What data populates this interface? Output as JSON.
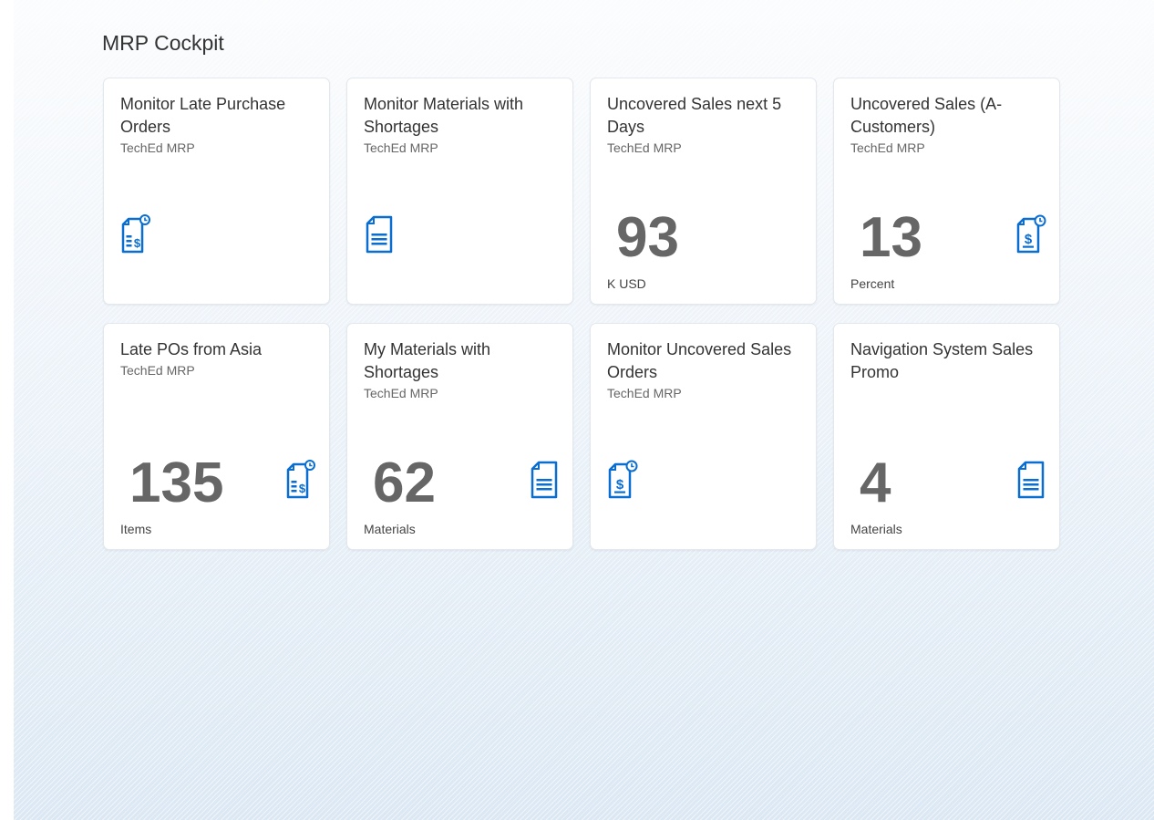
{
  "group": {
    "title": "MRP Cockpit"
  },
  "accent_color": "#0a6ed1",
  "tiles": [
    {
      "title": "Monitor Late Purchase Orders",
      "subtitle": "TechEd MRP",
      "number": "",
      "unit": "",
      "icon": "document-money-clock-icon"
    },
    {
      "title": "Monitor Materials with Shortages",
      "subtitle": "TechEd MRP",
      "number": "",
      "unit": "",
      "icon": "document-lines-icon"
    },
    {
      "title": "Uncovered Sales next 5 Days",
      "subtitle": "TechEd MRP",
      "number": "93",
      "unit": "K USD",
      "icon": ""
    },
    {
      "title": "Uncovered Sales (A-Customers)",
      "subtitle": "TechEd MRP",
      "number": "13",
      "unit": "Percent",
      "icon": "document-dollar-clock-icon"
    },
    {
      "title": "Late POs from Asia",
      "subtitle": "TechEd MRP",
      "number": "135",
      "unit": "Items",
      "icon": "document-money-clock-icon"
    },
    {
      "title": "My Materials with Shortages",
      "subtitle": "TechEd MRP",
      "number": "62",
      "unit": "Materials",
      "icon": "document-lines-icon"
    },
    {
      "title": "Monitor Uncovered Sales Orders",
      "subtitle": "TechEd MRP",
      "number": "",
      "unit": "",
      "icon": "document-dollar-clock-icon"
    },
    {
      "title": "Navigation System Sales Promo",
      "subtitle": "",
      "number": "4",
      "unit": "Materials",
      "icon": "document-lines-icon"
    }
  ]
}
